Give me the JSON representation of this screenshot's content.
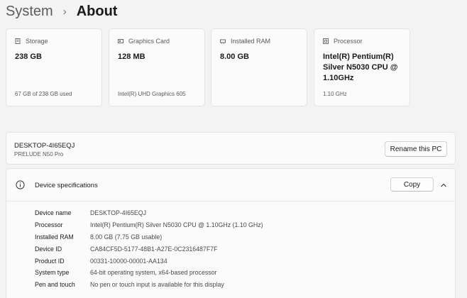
{
  "breadcrumb": {
    "parent": "System",
    "current": "About"
  },
  "cards": [
    {
      "label": "Storage",
      "value": "238 GB",
      "sub": "67 GB of 238 GB used",
      "icon": "storage-icon"
    },
    {
      "label": "Graphics Card",
      "value": "128 MB",
      "sub": "Intel(R) UHD Graphics 605",
      "icon": "graphics-card-icon"
    },
    {
      "label": "Installed RAM",
      "value": "8.00 GB",
      "sub": "",
      "icon": "ram-icon"
    },
    {
      "label": "Processor",
      "value": "Intel(R) Pentium(R) Silver N5030 CPU @ 1.10GHz",
      "sub": "1.10 GHz",
      "icon": "processor-icon"
    }
  ],
  "device": {
    "name": "DESKTOP-4I65EQJ",
    "model": "PRELUDE N50 Pro",
    "rename_label": "Rename this PC"
  },
  "specs": {
    "title": "Device specifications",
    "copy_label": "Copy",
    "rows": [
      {
        "key": "Device name",
        "value": "DESKTOP-4I65EQJ"
      },
      {
        "key": "Processor",
        "value": "Intel(R) Pentium(R) Silver N5030 CPU @ 1.10GHz (1.10 GHz)"
      },
      {
        "key": "Installed RAM",
        "value": "8.00 GB (7.75 GB usable)"
      },
      {
        "key": "Device ID",
        "value": "CA84CF5D-5177-48B1-A27E-0C2316487F7F"
      },
      {
        "key": "Product ID",
        "value": "00331-10000-00001-AA134"
      },
      {
        "key": "System type",
        "value": "64-bit operating system, x64-based processor"
      },
      {
        "key": "Pen and touch",
        "value": "No pen or touch input is available for this display"
      }
    ]
  },
  "colors": {
    "background": "#f3f3f3",
    "card": "#fbfbfb",
    "border": "#e3e3e3"
  }
}
